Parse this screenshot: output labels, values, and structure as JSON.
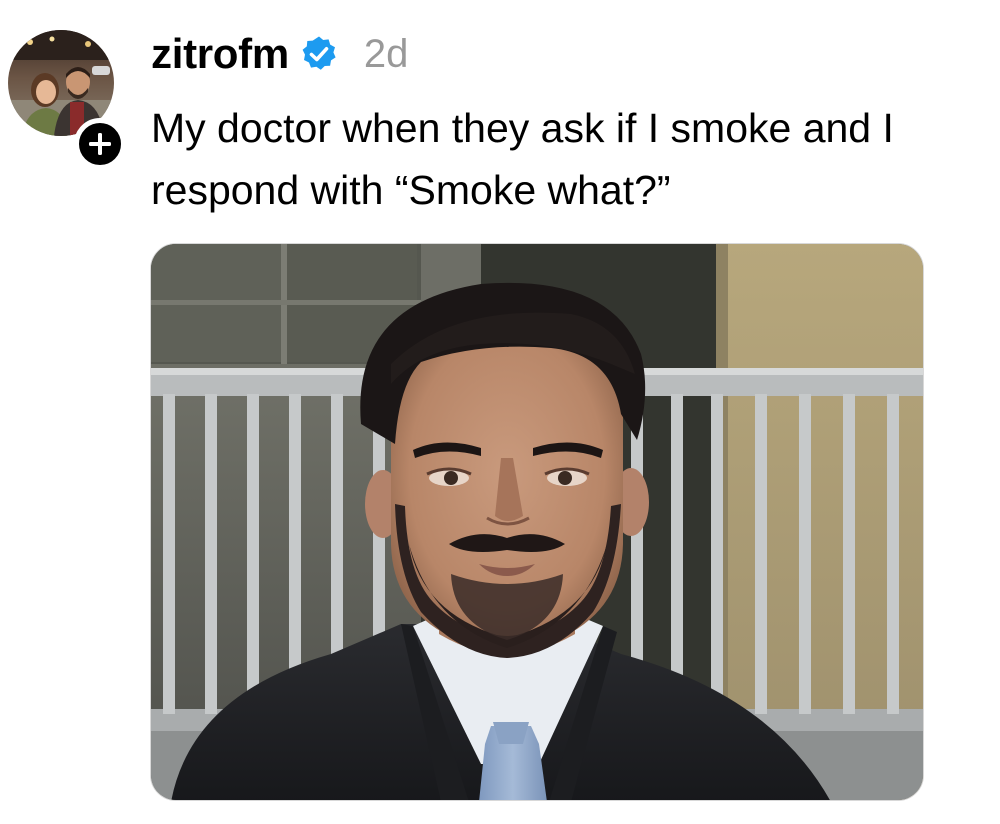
{
  "post": {
    "username": "zitrofm",
    "timestamp": "2d",
    "text_lines": [
      "My doctor when they ask if I smoke and I",
      "respond with “Smoke what?”"
    ],
    "verified": true,
    "avatar_icon": "profile-photo",
    "follow_icon": "plus-icon",
    "verified_icon": "verified-badge-icon",
    "media": {
      "type": "photo",
      "description": "man-in-suit-portrait"
    }
  },
  "colors": {
    "text": "#000000",
    "timestamp": "#999999",
    "verified_blue": "#1D9BF0",
    "follow_button": "#000000"
  }
}
